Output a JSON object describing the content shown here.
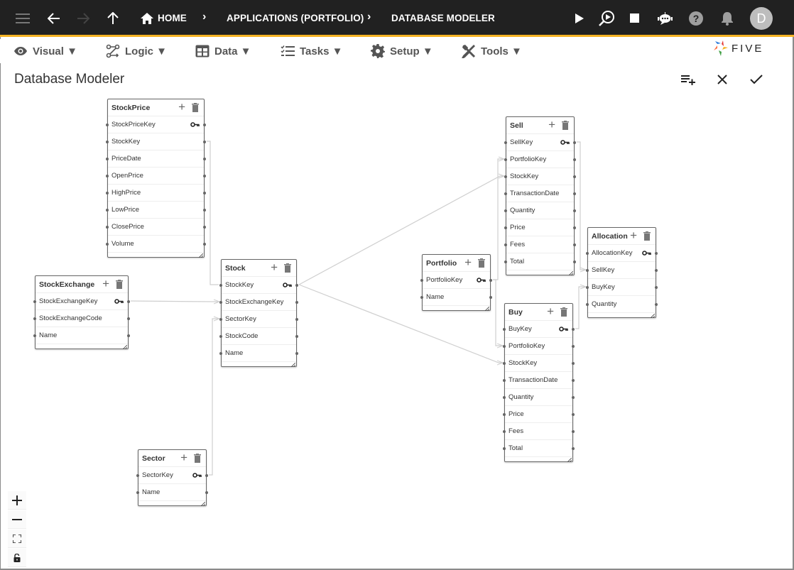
{
  "appbar": {
    "breadcrumbs": [
      "HOME",
      "APPLICATIONS (PORTFOLIO)",
      "DATABASE MODELER"
    ],
    "icons": [
      "menu-icon",
      "back-arrow-icon",
      "forward-arrow-icon",
      "up-arrow-icon",
      "home-icon",
      "run-icon",
      "debug-run-icon",
      "stop-icon",
      "chatbot-icon",
      "help-icon",
      "notifications-icon"
    ],
    "avatar_initial": "D"
  },
  "menubar": {
    "items": [
      {
        "label": "Visual ▼",
        "icon": "eye-icon"
      },
      {
        "label": "Logic ▼",
        "icon": "logic-flow-icon"
      },
      {
        "label": "Data ▼",
        "icon": "table-grid-icon"
      },
      {
        "label": "Tasks ▼",
        "icon": "checklist-icon"
      },
      {
        "label": "Setup ▼",
        "icon": "gear-icon"
      },
      {
        "label": "Tools ▼",
        "icon": "tools-icon"
      }
    ],
    "logo_text": "FIVE"
  },
  "page": {
    "title": "Database Modeler",
    "actions": [
      "add-list-icon",
      "close-icon",
      "check-icon"
    ]
  },
  "entities": [
    {
      "id": "stockprice",
      "name": "StockPrice",
      "fields": [
        "StockPriceKey",
        "StockKey",
        "PriceDate",
        "OpenPrice",
        "HighPrice",
        "LowPrice",
        "ClosePrice",
        "Volume"
      ],
      "primary_key": "StockPriceKey"
    },
    {
      "id": "stockexchange",
      "name": "StockExchange",
      "fields": [
        "StockExchangeKey",
        "StockExchangeCode",
        "Name"
      ],
      "primary_key": "StockExchangeKey"
    },
    {
      "id": "stock",
      "name": "Stock",
      "fields": [
        "StockKey",
        "StockExchangeKey",
        "SectorKey",
        "StockCode",
        "Name"
      ],
      "primary_key": "StockKey"
    },
    {
      "id": "sector",
      "name": "Sector",
      "fields": [
        "SectorKey",
        "Name"
      ],
      "primary_key": "SectorKey"
    },
    {
      "id": "portfolio",
      "name": "Portfolio",
      "fields": [
        "PortfolioKey",
        "Name"
      ],
      "primary_key": "PortfolioKey"
    },
    {
      "id": "sell",
      "name": "Sell",
      "fields": [
        "SellKey",
        "PortfolioKey",
        "StockKey",
        "TransactionDate",
        "Quantity",
        "Price",
        "Fees",
        "Total"
      ],
      "primary_key": "SellKey"
    },
    {
      "id": "buy",
      "name": "Buy",
      "fields": [
        "BuyKey",
        "PortfolioKey",
        "StockKey",
        "TransactionDate",
        "Quantity",
        "Price",
        "Fees",
        "Total"
      ],
      "primary_key": "BuyKey"
    },
    {
      "id": "allocation",
      "name": "Allocation",
      "fields": [
        "AllocationKey",
        "SellKey",
        "BuyKey",
        "Quantity"
      ],
      "primary_key": "AllocationKey"
    }
  ],
  "relationships": [
    {
      "from": "stock.StockKey",
      "to": "stockprice.StockKey"
    },
    {
      "from": "stockexchange.StockExchangeKey",
      "to": "stock.StockExchangeKey"
    },
    {
      "from": "sector.SectorKey",
      "to": "stock.SectorKey"
    },
    {
      "from": "stock.StockKey",
      "to": "sell.StockKey"
    },
    {
      "from": "stock.StockKey",
      "to": "buy.StockKey"
    },
    {
      "from": "portfolio.PortfolioKey",
      "to": "sell.PortfolioKey"
    },
    {
      "from": "portfolio.PortfolioKey",
      "to": "buy.PortfolioKey"
    },
    {
      "from": "sell.SellKey",
      "to": "allocation.SellKey"
    },
    {
      "from": "buy.BuyKey",
      "to": "allocation.BuyKey"
    }
  ],
  "zoom_controls": [
    "zoom-in-icon",
    "zoom-out-icon",
    "fit-view-icon",
    "lock-icon"
  ]
}
